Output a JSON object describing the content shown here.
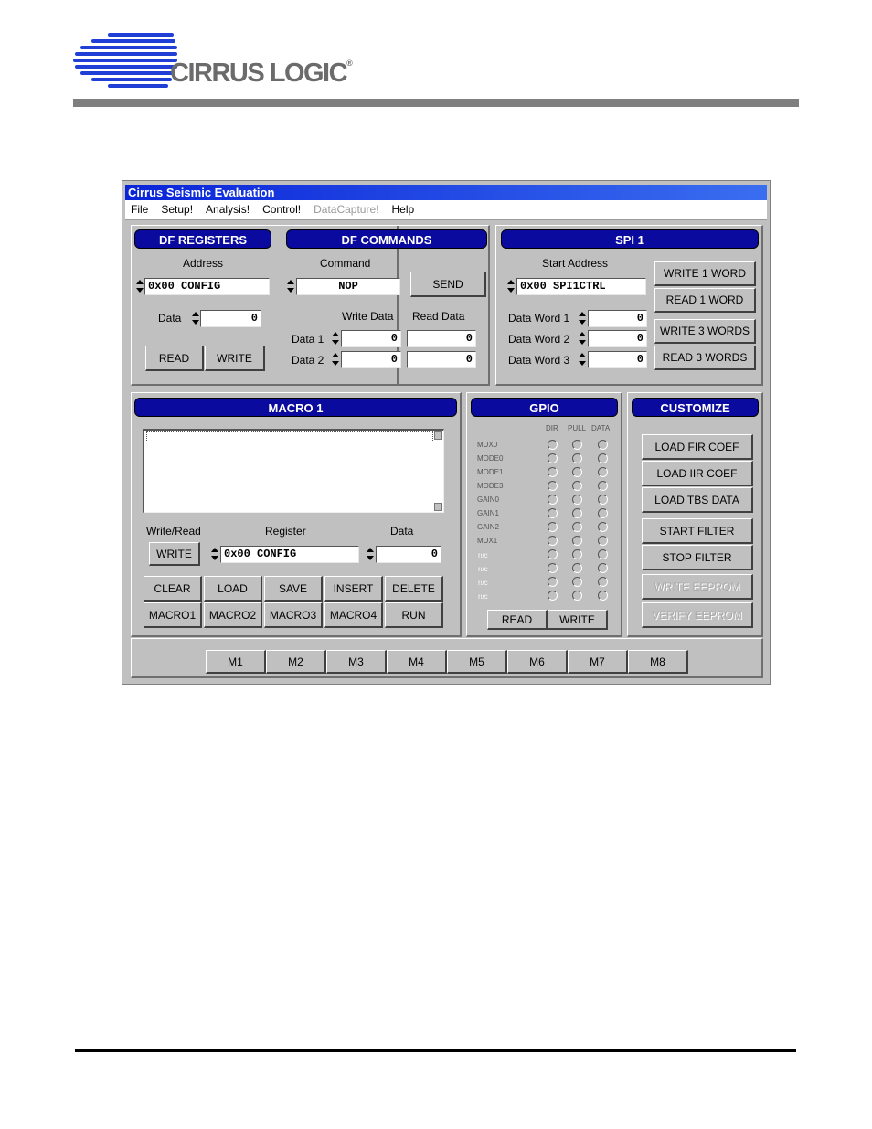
{
  "brand": {
    "logo_text": "CIRRUS LOGIC",
    "logo_mark": "®",
    "logo_color": "#1f3fd6"
  },
  "window": {
    "title": "Cirrus Seismic Evaluation",
    "menu": [
      "File",
      "Setup!",
      "Analysis!",
      "Control!",
      "DataCapture!",
      "Help"
    ]
  },
  "df_registers": {
    "header": "DF REGISTERS",
    "address_label": "Address",
    "address_value": "0x00  CONFIG",
    "data_label": "Data",
    "data_value": "0",
    "read_button": "READ",
    "write_button": "WRITE"
  },
  "df_commands": {
    "header": "DF COMMANDS",
    "command_label": "Command",
    "command_value": "NOP",
    "send_button": "SEND",
    "write_data_label": "Write Data",
    "read_data_label": "Read Data",
    "rows": [
      {
        "label": "Data 1",
        "write": "0",
        "read": "0"
      },
      {
        "label": "Data 2",
        "write": "0",
        "read": "0"
      }
    ]
  },
  "spi1": {
    "header": "SPI 1",
    "start_address_label": "Start Address",
    "start_address_value": "0x00   SPI1CTRL",
    "words": [
      {
        "label": "Data Word 1",
        "value": "0"
      },
      {
        "label": "Data Word 2",
        "value": "0"
      },
      {
        "label": "Data Word 3",
        "value": "0"
      }
    ],
    "buttons": [
      "WRITE 1 WORD",
      "READ 1 WORD",
      "WRITE 3 WORDS",
      "READ 3 WORDS"
    ]
  },
  "macro": {
    "header": "MACRO 1",
    "write_read_label": "Write/Read",
    "register_label": "Register",
    "data_label": "Data",
    "write_button": "WRITE",
    "register_value": "0x00  CONFIG",
    "data_value": "0",
    "row1_buttons": [
      "CLEAR",
      "LOAD",
      "SAVE",
      "INSERT",
      "DELETE"
    ],
    "row2_buttons": [
      "MACRO1",
      "MACRO2",
      "MACRO3",
      "MACRO4",
      "RUN"
    ]
  },
  "gpio": {
    "header": "GPIO",
    "columns": [
      "DIR",
      "PULL",
      "DATA"
    ],
    "rows": [
      "MUX0",
      "MODE0",
      "MODE1",
      "MODE3",
      "GAIN0",
      "GAIN1",
      "GAIN2",
      "MUX1",
      "n/c",
      "n/c",
      "n/c",
      "n/c"
    ],
    "read_button": "READ",
    "write_button": "WRITE"
  },
  "customize": {
    "header": "CUSTOMIZE",
    "buttons": [
      "LOAD FIR COEF",
      "LOAD IIR COEF",
      "LOAD TBS DATA",
      "START FILTER",
      "STOP FILTER"
    ],
    "disabled_buttons": [
      "WRITE EEPROM",
      "VERIFY EEPROM"
    ]
  },
  "m_buttons": [
    "M1",
    "M2",
    "M3",
    "M4",
    "M5",
    "M6",
    "M7",
    "M8"
  ]
}
